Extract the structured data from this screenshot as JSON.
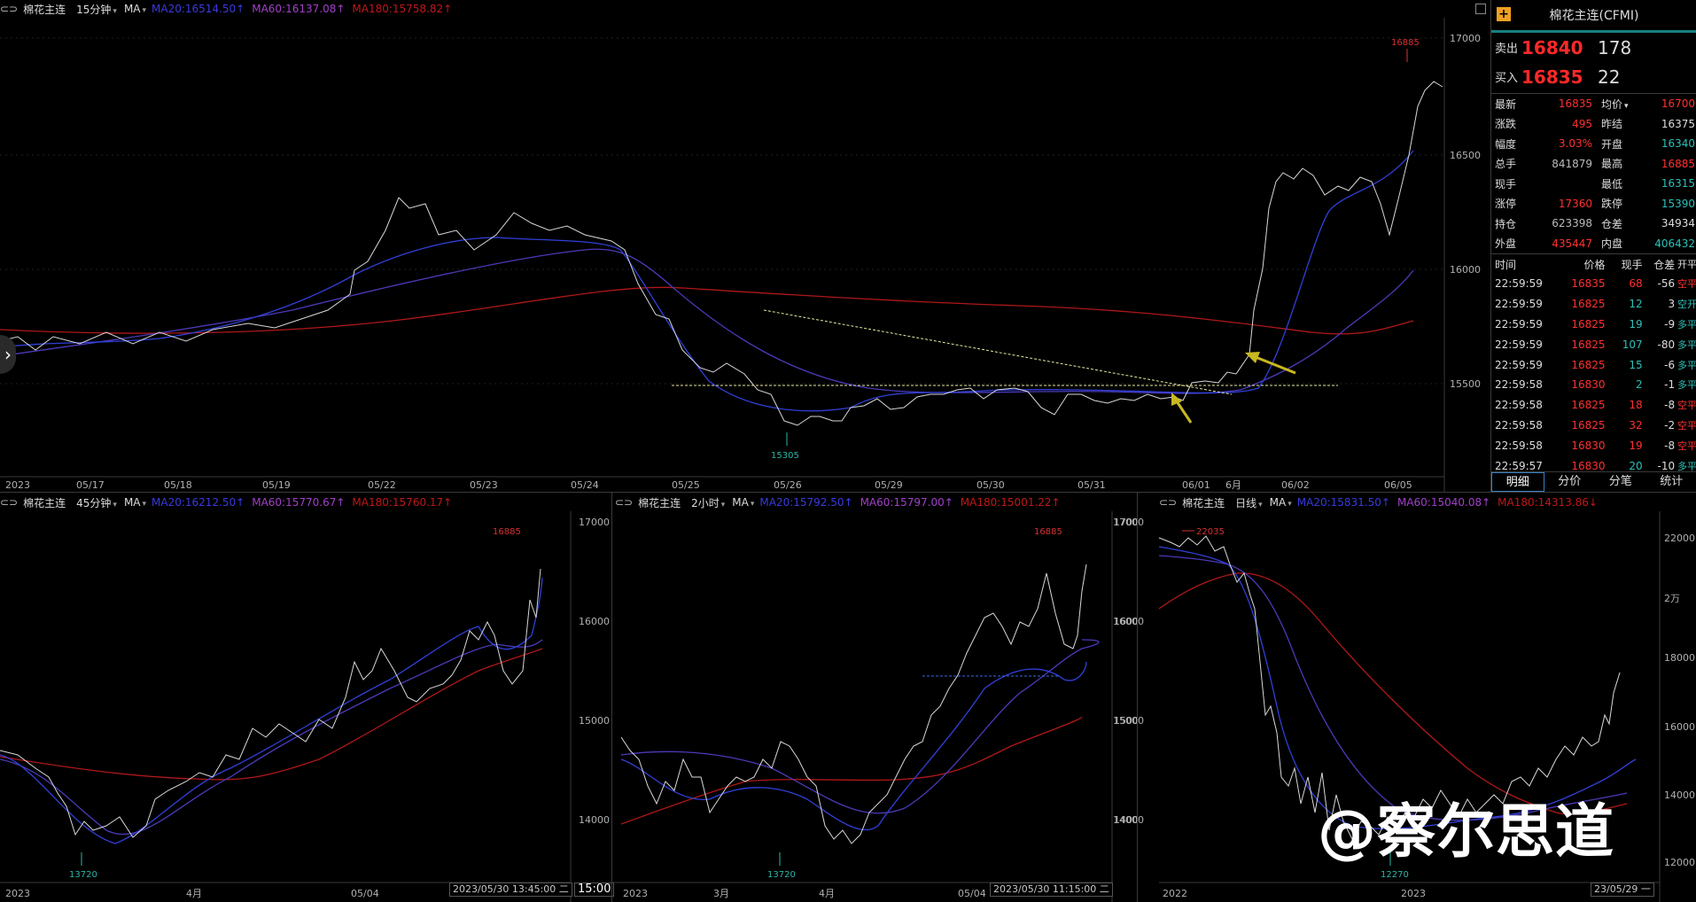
{
  "top": {
    "name": "棉花主连",
    "period": "15分钟",
    "ma": "MA",
    "ma20": "MA20:16514.50↑",
    "ma60": "MA60:16137.08↑",
    "ma180": "MA180:15758.82↑",
    "yticks": [
      "17000",
      "16500",
      "16000",
      "15500"
    ],
    "xticks": [
      "2023",
      "05/17",
      "05/18",
      "05/19",
      "05/22",
      "05/23",
      "05/24",
      "05/25",
      "05/26",
      "05/29",
      "05/30",
      "05/31",
      "06/01",
      "6月",
      "06/02",
      "06/05"
    ],
    "hi": "16885",
    "lo": "15305"
  },
  "bl": {
    "name": "棉花主连",
    "period": "45分钟",
    "ma": "MA",
    "ma20": "MA20:16212.50↑",
    "ma60": "MA60:15770.67↑",
    "ma180": "MA180:15760.17↑",
    "yticks": [
      "17000",
      "16000",
      "15000",
      "14000"
    ],
    "xticks": [
      "2023",
      "4月",
      "05/04"
    ],
    "hi": "16885",
    "lo": "13720",
    "time": "2023/05/30 13:45:00 二"
  },
  "bm": {
    "name": "棉花主连",
    "period": "2小时",
    "ma": "MA",
    "ma20": "MA20:15792.50↑",
    "ma60": "MA60:15797.00↑",
    "ma180": "MA180:15001.22↑",
    "yticks": [
      "17000",
      "16000",
      "15000",
      "14000"
    ],
    "xticks": [
      "2023",
      "3月",
      "4月",
      "05/04"
    ],
    "hi": "16885",
    "lo": "13720",
    "time": "2023/05/30 11:15:00 二"
  },
  "br": {
    "name": "棉花主连",
    "period": "日线",
    "ma": "MA",
    "ma20": "MA20:15831.50↑",
    "ma60": "MA60:15040.08↑",
    "ma180": "MA180:14313.86↓",
    "ylticks": [
      "17000",
      "16000",
      "15000",
      "14000"
    ],
    "yrticks": [
      "22000",
      "2万",
      "18000",
      "16000",
      "14000",
      "12000"
    ],
    "xticks": [
      "2022",
      "2023"
    ],
    "hi": "22035",
    "lo": "12270",
    "time": "23/05/29 一"
  },
  "bottom_time": "15:00",
  "panel": {
    "title": "棉花主连(CFMI)",
    "sell_label": "卖出",
    "sell_price": "16840",
    "sell_vol": "178",
    "buy_label": "买入",
    "buy_price": "16835",
    "buy_vol": "22",
    "stats": [
      {
        "l1": "最新",
        "v1": "16835",
        "k1": "r",
        "l2": "均价",
        "v2": "16700",
        "k2": "r"
      },
      {
        "l1": "涨跌",
        "v1": "495",
        "k1": "r",
        "l2": "昨结",
        "v2": "16375",
        "k2": "w"
      },
      {
        "l1": "幅度",
        "v1": "3.03%",
        "k1": "r",
        "l2": "开盘",
        "v2": "16340",
        "k2": "g"
      },
      {
        "l1": "总手",
        "v1": "841879",
        "k1": "gw",
        "l2": "最高",
        "v2": "16885",
        "k2": "r"
      },
      {
        "l1": "现手",
        "v1": "",
        "k1": "gw",
        "l2": "最低",
        "v2": "16315",
        "k2": "g"
      },
      {
        "l1": "涨停",
        "v1": "17360",
        "k1": "r",
        "l2": "跌停",
        "v2": "15390",
        "k2": "g"
      },
      {
        "l1": "持仓",
        "v1": "623398",
        "k1": "gw",
        "l2": "仓差",
        "v2": "34934",
        "k2": "w"
      },
      {
        "l1": "外盘",
        "v1": "435447",
        "k1": "r",
        "l2": "内盘",
        "v2": "406432",
        "k2": "g"
      }
    ],
    "trade_headers": [
      "时间",
      "价格",
      "现手",
      "仓差",
      "开平"
    ],
    "trades": [
      {
        "t": "22:59:59",
        "p": "16835",
        "v": "68",
        "vk": "r",
        "o": "-56",
        "ty": "空平",
        "tk": "r"
      },
      {
        "t": "22:59:59",
        "p": "16825",
        "v": "12",
        "vk": "g",
        "o": "3",
        "ty": "空开",
        "tk": "g"
      },
      {
        "t": "22:59:59",
        "p": "16825",
        "v": "19",
        "vk": "g",
        "o": "-9",
        "ty": "多平",
        "tk": "g"
      },
      {
        "t": "22:59:59",
        "p": "16825",
        "v": "107",
        "vk": "g",
        "o": "-80",
        "ty": "多平",
        "tk": "g"
      },
      {
        "t": "22:59:59",
        "p": "16825",
        "v": "15",
        "vk": "g",
        "o": "-6",
        "ty": "多平",
        "tk": "g"
      },
      {
        "t": "22:59:58",
        "p": "16830",
        "v": "2",
        "vk": "g",
        "o": "-1",
        "ty": "多平",
        "tk": "g"
      },
      {
        "t": "22:59:58",
        "p": "16825",
        "v": "18",
        "vk": "r",
        "o": "-8",
        "ty": "空平",
        "tk": "r"
      },
      {
        "t": "22:59:58",
        "p": "16825",
        "v": "32",
        "vk": "r",
        "o": "-2",
        "ty": "空平",
        "tk": "r"
      },
      {
        "t": "22:59:58",
        "p": "16830",
        "v": "19",
        "vk": "r",
        "o": "-8",
        "ty": "空平",
        "tk": "r"
      },
      {
        "t": "22:59:57",
        "p": "16830",
        "v": "20",
        "vk": "g",
        "o": "-10",
        "ty": "多平",
        "tk": "g"
      }
    ],
    "tabs": [
      "明细",
      "分价",
      "分笔",
      "统计"
    ]
  },
  "watermark": "@察尔思道"
}
